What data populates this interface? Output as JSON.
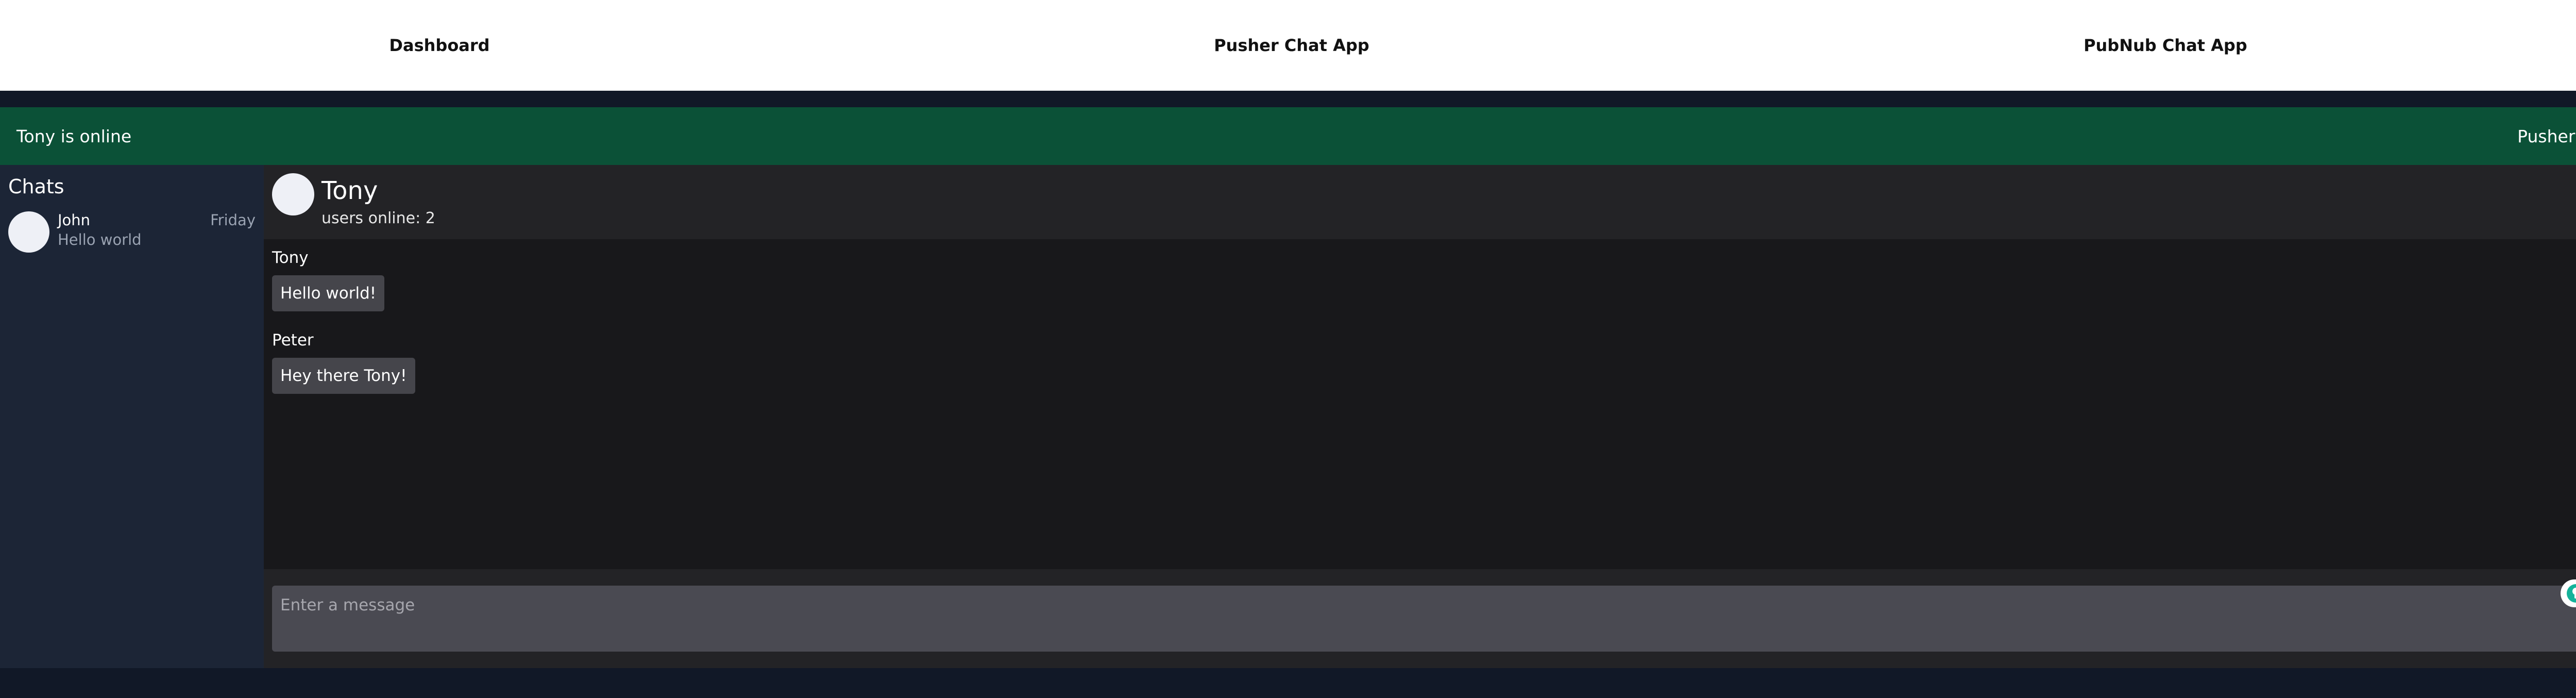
{
  "nav": {
    "links": [
      {
        "label": "Dashboard"
      },
      {
        "label": "Pusher Chat App"
      },
      {
        "label": "PubNub Chat App"
      }
    ]
  },
  "status_bar": {
    "status_text": "Tony is online",
    "app_label": "Pusher Chat"
  },
  "sidebar": {
    "title": "Chats",
    "items": [
      {
        "name": "John",
        "preview": "Hello world",
        "time": "Friday"
      }
    ]
  },
  "chat": {
    "header": {
      "name": "Tony",
      "users_online": "users online: 2"
    },
    "messages": [
      {
        "sender": "Tony",
        "text": "Hello world!"
      },
      {
        "sender": "Peter",
        "text": "Hey there Tony!"
      }
    ],
    "composer": {
      "placeholder": "Enter a message",
      "value": ""
    }
  },
  "colors": {
    "status_bar": "#0b5137",
    "sidebar": "#1c2536",
    "chat_bg": "#18181b",
    "bubble": "#45454b",
    "input": "#4a4a52"
  },
  "icons": [
    "avatar-placeholder",
    "bulb-icon",
    "grammarly-icon"
  ]
}
